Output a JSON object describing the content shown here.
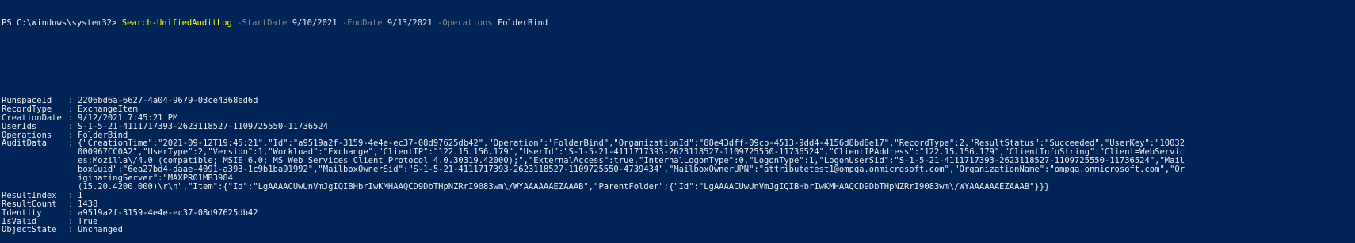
{
  "command": {
    "prompt": "PS C:\\Windows\\system32>",
    "cmdlet": "Search-UnifiedAuditLog",
    "params": [
      {
        "name": "-StartDate",
        "value": "9/10/2021"
      },
      {
        "name": "-EndDate",
        "value": "9/13/2021"
      },
      {
        "name": "-Operations",
        "value": "FolderBind"
      }
    ]
  },
  "properties": [
    {
      "name": "RunspaceId",
      "lines": [
        "2206bd6a-6627-4a04-9679-03ce4368ed6d"
      ]
    },
    {
      "name": "RecordType",
      "lines": [
        "ExchangeItem"
      ]
    },
    {
      "name": "CreationDate",
      "lines": [
        "9/12/2021 7:45:21 PM"
      ]
    },
    {
      "name": "UserIds",
      "lines": [
        "S-1-5-21-4111717393-2623118527-1109725550-11736524"
      ]
    },
    {
      "name": "Operations",
      "lines": [
        "FolderBind"
      ]
    },
    {
      "name": "AuditData",
      "lines": [
        "{\"CreationTime\":\"2021-09-12T19:45:21\",\"Id\":\"a9519a2f-3159-4e4e-ec37-08d97625db42\",\"Operation\":\"FolderBind\",\"OrganizationId\":\"88e43dff-09cb-4513-9dd4-4156d8bd8e17\",\"RecordType\":2,\"ResultStatus\":\"Succeeded\",\"UserKey\":\"10032",
        "000967CC0A2\",\"UserType\":2,\"Version\":1,\"Workload\":\"Exchange\",\"ClientIP\":\"122.15.156.179\",\"UserId\":\"S-1-5-21-4111717393-2623118527-1109725550-11736524\",\"ClientIPAddress\":\"122.15.156.179\",\"ClientInfoString\":\"Client=WebServic",
        "es;Mozilla\\/4.0 (compatible; MSIE 6.0; MS Web Services Client Protocol 4.0.30319.42000);\",\"ExternalAccess\":true,\"InternalLogonType\":0,\"LogonType\":1,\"LogonUserSid\":\"S-1-5-21-4111717393-2623118527-1109725550-11736524\",\"Mail",
        "boxGuid\":\"6ea27bd4-daae-4091-a393-1c9b1ba91992\",\"MailboxOwnerSid\":\"S-1-5-21-4111717393-2623118527-1109725550-4739434\",\"MailboxOwnerUPN\":\"attributetest1@ompqa.onmicrosoft.com\",\"OrganizationName\":\"ompqa.onmicrosoft.com\",\"Or",
        "iginatingServer\":\"MAXPR01MB3984",
        "(15.20.4200.000)\\r\\n\",\"Item\":{\"Id\":\"LgAAAACUwUnVmJgIQIBHbrIwKMHAAQCD9DbTHpNZRrI9083wm\\/WYAAAAAAEZAAAB\",\"ParentFolder\":{\"Id\":\"LgAAAACUwUnVmJgIQIBHbrIwKMHAAQCD9DbTHpNZRrI9083wm\\/WYAAAAAAEZAAAB\"}}}"
      ]
    },
    {
      "name": "ResultIndex",
      "lines": [
        "1"
      ]
    },
    {
      "name": "ResultCount",
      "lines": [
        "1438"
      ]
    },
    {
      "name": "Identity",
      "lines": [
        "a9519a2f-3159-4e4e-ec37-08d97625db42"
      ]
    },
    {
      "name": "IsValid",
      "lines": [
        "True"
      ]
    },
    {
      "name": "ObjectState",
      "lines": [
        "Unchanged"
      ]
    }
  ],
  "separator": ":",
  "colors": {
    "background": "#012456",
    "text": "#eeedf0",
    "cmdlet": "#ffff00",
    "param": "#8a8a8a"
  }
}
